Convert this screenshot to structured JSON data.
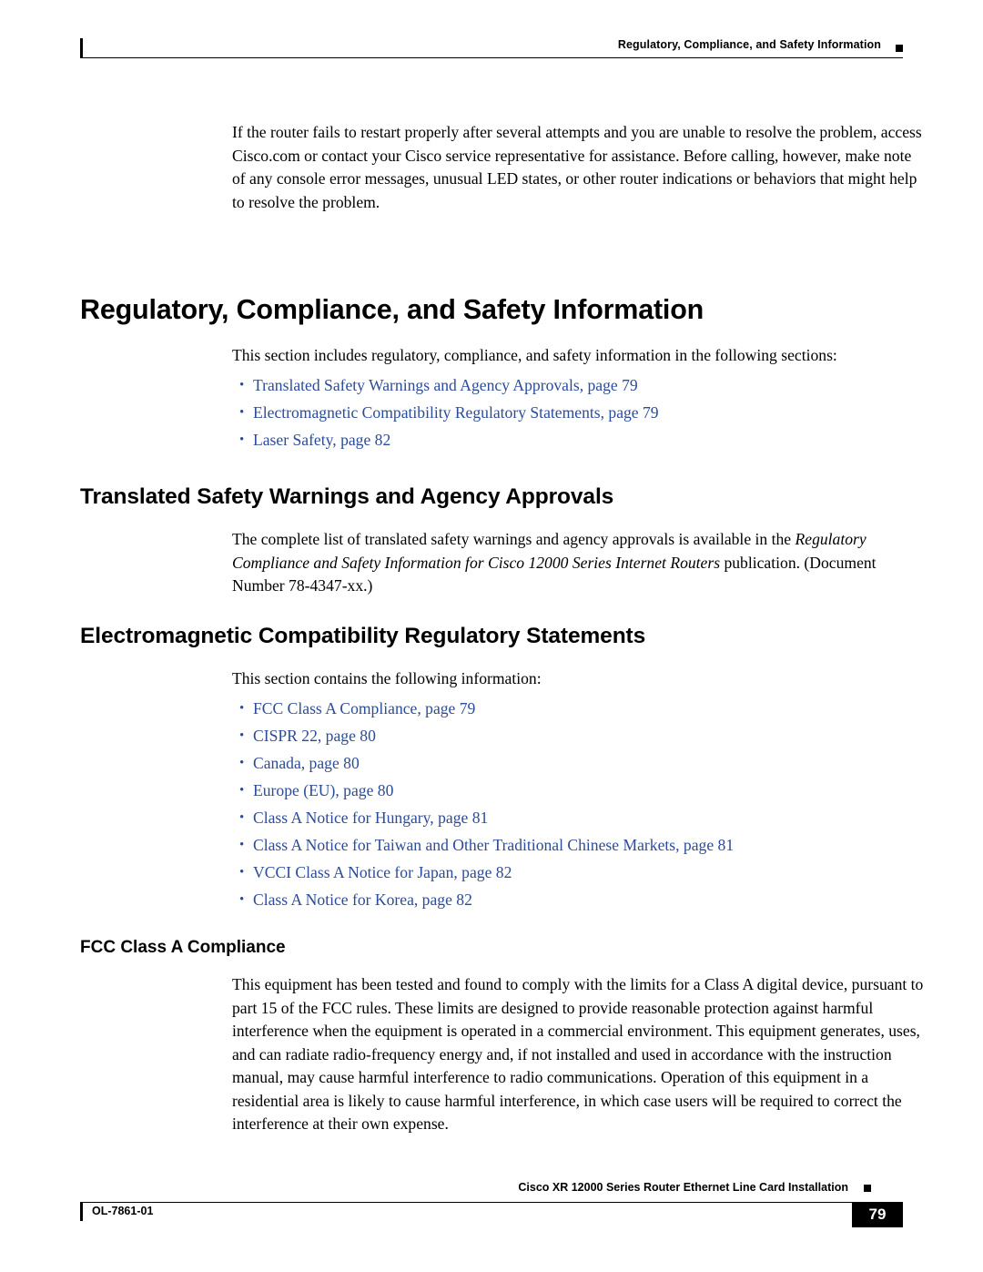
{
  "header": {
    "title": "Regulatory, Compliance, and Safety Information"
  },
  "intro_paragraph": "If the router fails to restart properly after several attempts and you are unable to resolve the problem, access Cisco.com or contact your Cisco service representative for assistance. Before calling, however, make note of any console error messages, unusual LED states, or other router indications or behaviors that might help to resolve the problem.",
  "section_main": {
    "heading": "Regulatory, Compliance, and Safety Information",
    "intro": "This section includes regulatory, compliance, and safety information in the following sections:",
    "links": [
      "Translated Safety Warnings and Agency Approvals, page 79",
      "Electromagnetic Compatibility Regulatory Statements, page 79",
      "Laser Safety, page 82"
    ]
  },
  "section_translated": {
    "heading": "Translated Safety Warnings and Agency Approvals",
    "para_part1": "The complete list of translated safety warnings and agency approvals is available in the ",
    "para_italic": "Regulatory Compliance and Safety Information for Cisco 12000 Series Internet Routers",
    "para_part2": " publication. (Document Number 78-4347-xx.)"
  },
  "section_emc": {
    "heading": "Electromagnetic Compatibility Regulatory Statements",
    "intro": "This section contains the following information:",
    "links": [
      "FCC Class A Compliance, page 79",
      "CISPR 22, page 80",
      "Canada, page 80",
      "Europe (EU), page 80",
      "Class A Notice for Hungary, page 81",
      "Class A Notice for Taiwan and Other Traditional Chinese Markets, page 81",
      "VCCI Class A Notice for Japan, page 82",
      "Class A Notice for Korea, page 82"
    ]
  },
  "section_fcc": {
    "heading": "FCC Class A Compliance",
    "paragraph": "This equipment has been tested and found to comply with the limits for a Class A digital device, pursuant to part 15 of the FCC rules. These limits are designed to provide reasonable protection against harmful interference when the equipment is operated in a commercial environment. This equipment generates, uses, and can radiate radio-frequency energy and, if not installed and used in accordance with the instruction manual, may cause harmful interference to radio communications. Operation of this equipment in a residential area is likely to cause harmful interference, in which case users will be required to correct the interference at their own expense."
  },
  "footer": {
    "title": "Cisco XR 12000 Series Router Ethernet Line Card Installation",
    "doc_id": "OL-7861-01",
    "page_number": "79"
  },
  "colors": {
    "link": "#2b4b9b",
    "text": "#000000",
    "background": "#ffffff"
  }
}
